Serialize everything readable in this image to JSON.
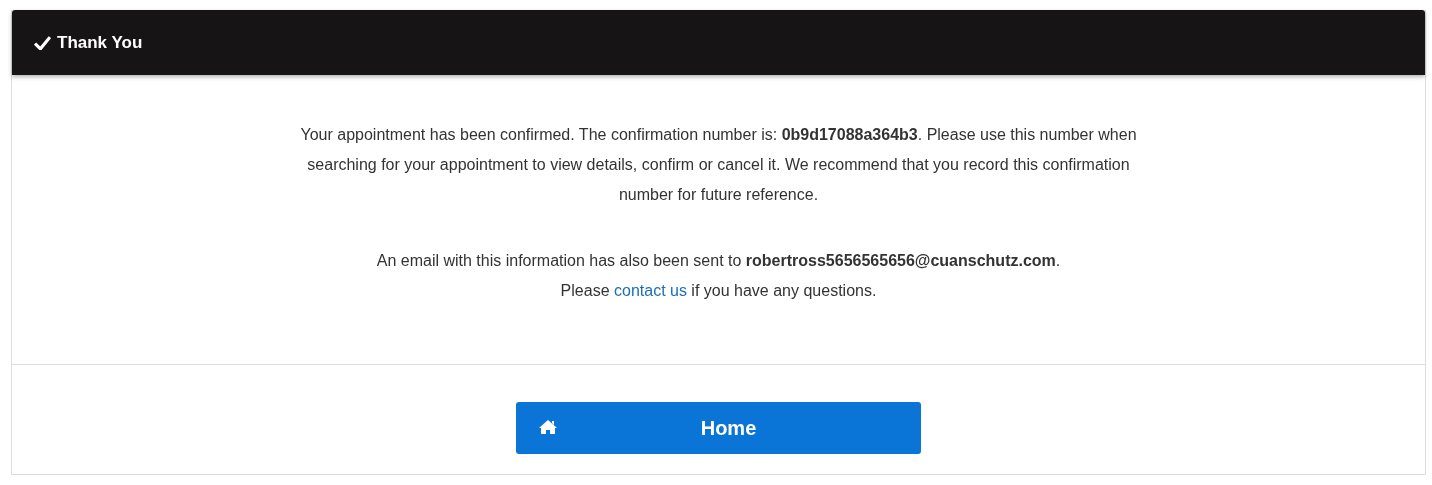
{
  "panel": {
    "title": "Thank You"
  },
  "confirmation_text": "Your appointment has been confirmed. The confirmation number is: **0b9d17088a364b3**. Please use this number when searching for your appointment to view details, confirm or cancel it. We recommend that you record this confirmation number for future reference.",
  "email_notice": "An email with this information has also been sent to **robertross5656565656@cuanschutz.com**.",
  "contact_line": {
    "before": "Please",
    "link": "contact us",
    "after": "if you have any questions."
  },
  "home_button": {
    "label": "Home"
  }
}
